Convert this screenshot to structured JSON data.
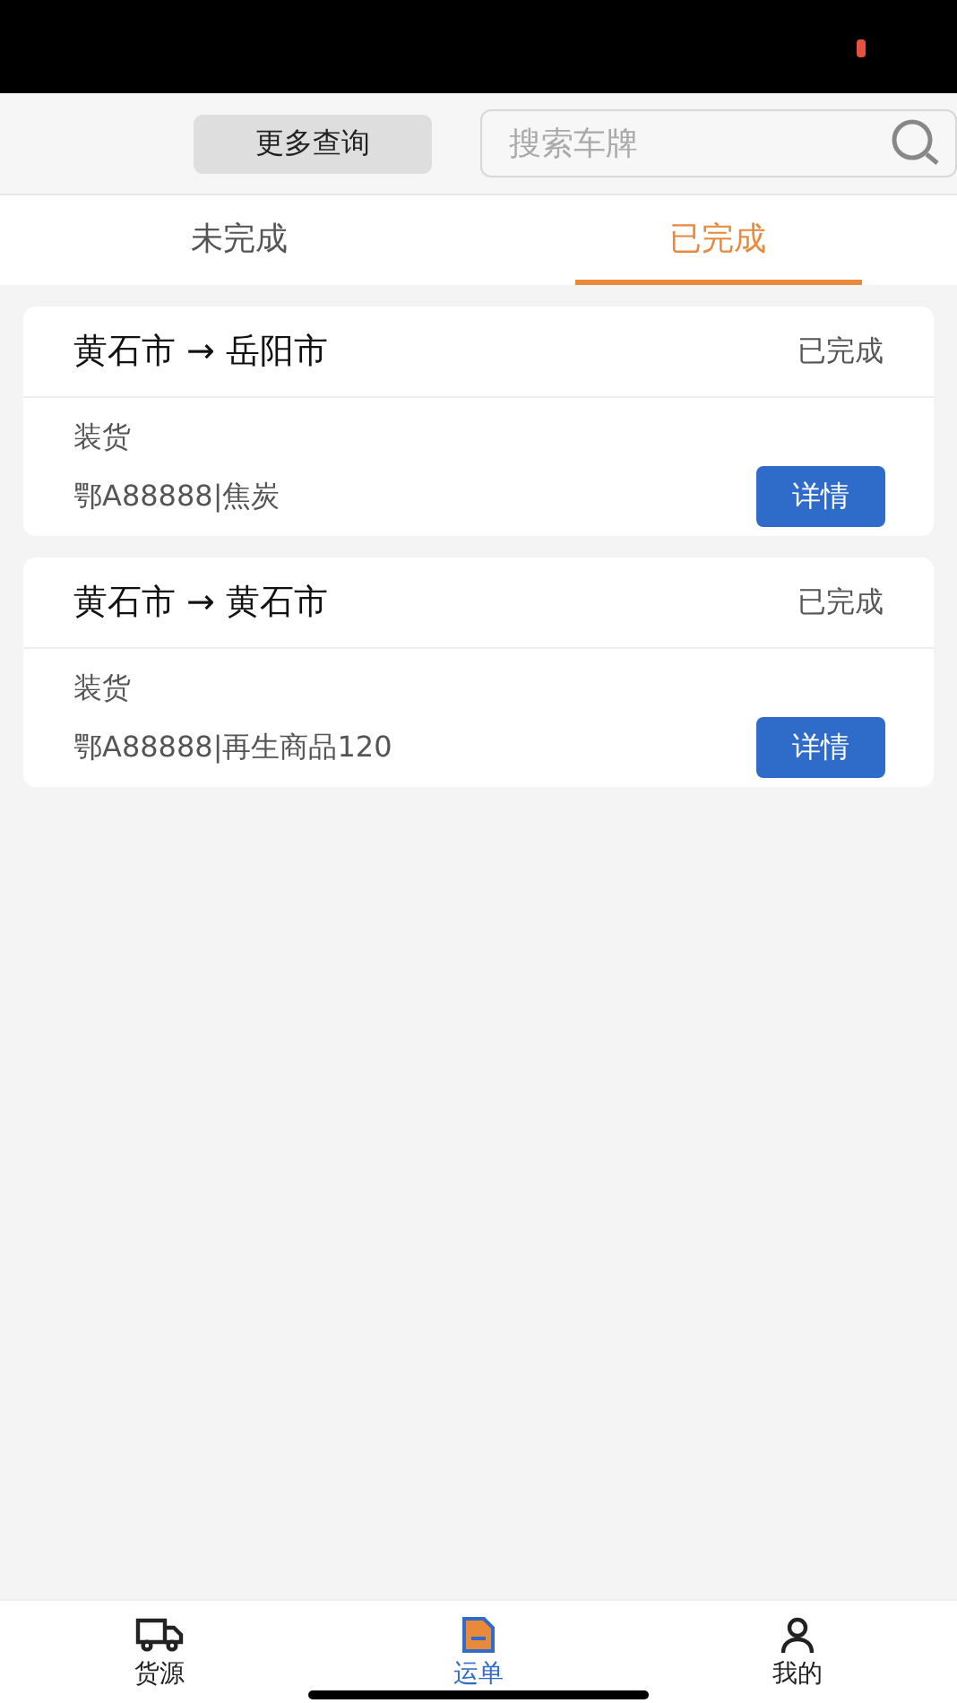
{
  "header": {
    "more_button": "更多查询",
    "search": {
      "placeholder": "搜索车牌"
    }
  },
  "tabs": [
    {
      "label": "未完成",
      "selected": false
    },
    {
      "label": "已完成",
      "selected": true
    }
  ],
  "orders": [
    {
      "route": "黄石市 → 岳阳市",
      "status": "已完成",
      "stage": "装货",
      "detail": "鄂A88888|焦炭",
      "button": "详情"
    },
    {
      "route": "黄石市 → 黄石市",
      "status": "已完成",
      "stage": "装货",
      "detail": "鄂A88888|再生商品120",
      "button": "详情"
    }
  ],
  "nav": [
    {
      "label": "货源",
      "selected": false
    },
    {
      "label": "运单",
      "selected": true
    },
    {
      "label": "我的",
      "selected": false
    }
  ]
}
